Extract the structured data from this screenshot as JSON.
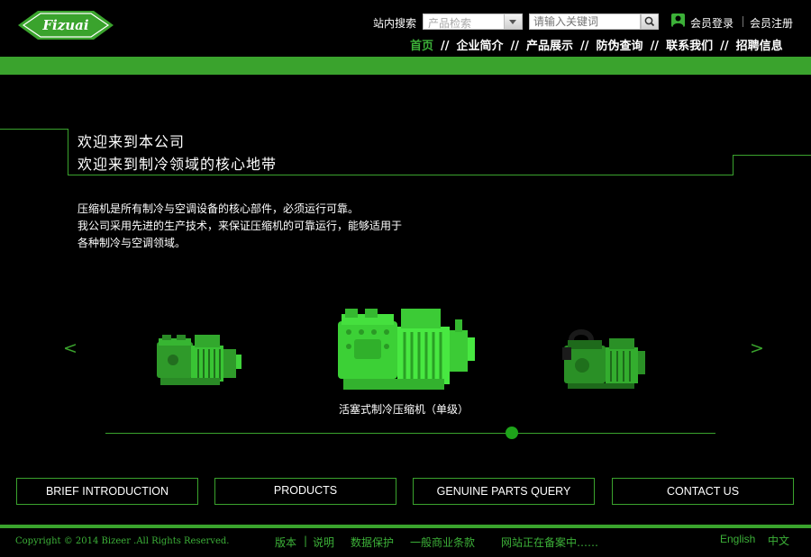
{
  "header": {
    "logo_text": "Fizuai",
    "search_label": "站内搜索",
    "category_select_value": "产品检索",
    "keyword_placeholder": "请输入关键词",
    "login_label": "会员登录",
    "register_label": "会员注册",
    "nav_items": [
      "首页",
      "企业简介",
      "产品展示",
      "防伪查询",
      "联系我们",
      "招聘信息"
    ],
    "nav_separator": "//"
  },
  "welcome": {
    "line1": "欢迎来到本公司",
    "line2": "欢迎来到制冷领域的核心地带"
  },
  "intro": [
    "压缩机是所有制冷与空调设备的核心部件，必须运行可靠。",
    "我公司采用先进的生产技术，来保证压缩机的可靠运行，能够适用于",
    "各种制冷与空调领域。"
  ],
  "carousel": {
    "prev_symbol": "<",
    "next_symbol": ">",
    "caption": "活塞式制冷压缩机（单级）",
    "product_color": "#3fd33a"
  },
  "buttons": [
    "BRIEF INTRODUCTION",
    "PRODUCTS",
    "GENUINE PARTS QUERY",
    "CONTACT US"
  ],
  "footer": {
    "copyright": "Copyright © 2014 Bizeer .All Rights Reserved.",
    "links": [
      "版本",
      "说明",
      "数据保护",
      "一般商业条款",
      "网站正在备案中……"
    ],
    "lang_english": "English",
    "lang_chinese": "中文"
  },
  "colors": {
    "accent": "#3aa32d",
    "background": "#000000"
  },
  "icons": {
    "user": "user-icon",
    "search": "magnifier-icon"
  }
}
